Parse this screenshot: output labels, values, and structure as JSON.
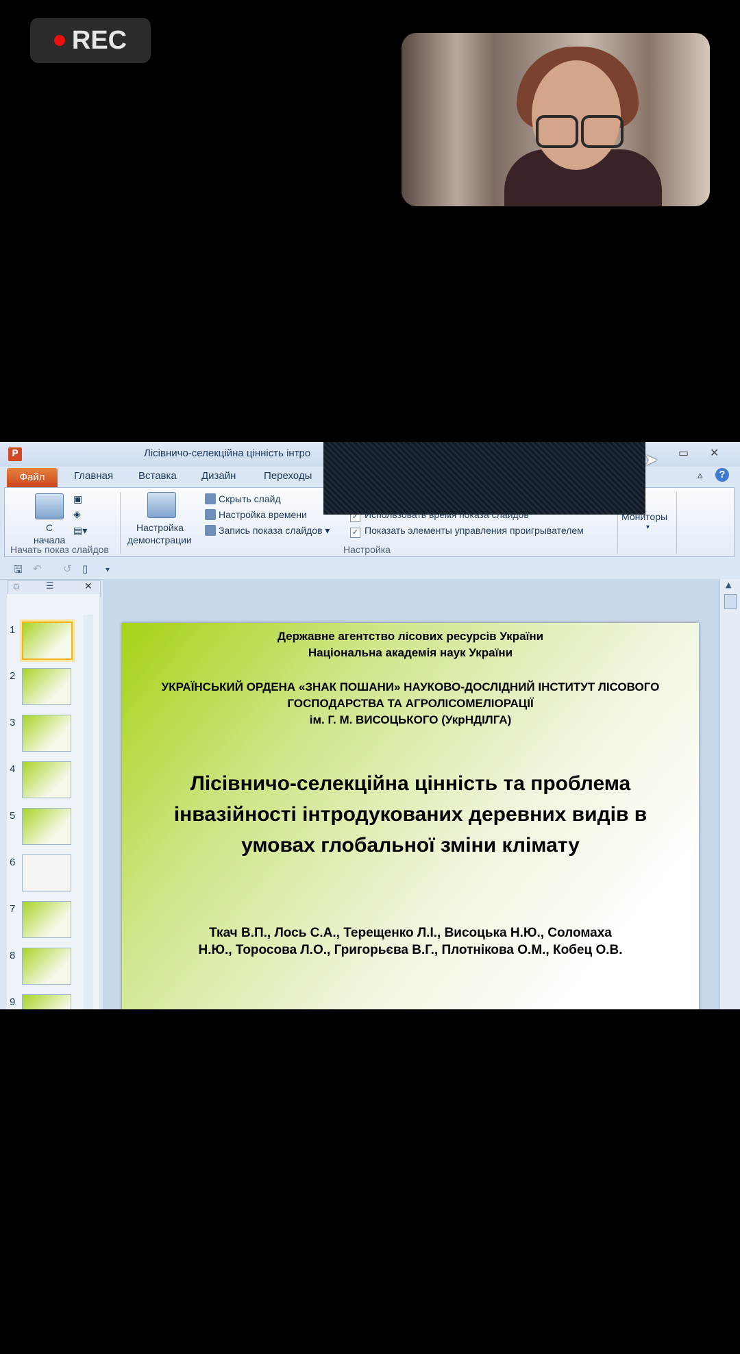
{
  "recording": {
    "label": "REC",
    "color": "#e81010"
  },
  "app": {
    "title": "Лісівничо-селекційна цінність інтро",
    "icon": "powerpoint-icon",
    "tabs": {
      "file": "Файл",
      "home": "Главная",
      "insert": "Вставка",
      "design": "Дизайн",
      "transitions": "Переходы"
    },
    "ribbon": {
      "from_start": "С",
      "from_start2": "начала",
      "setup_show": "Настройка",
      "setup_show2": "демонстрации",
      "hide_slide": "Скрыть слайд",
      "rehearse": "Настройка времени",
      "record": "Запись показа слайдов",
      "use_timings": "Использовать время показа слайдов",
      "show_controls": "Показать элементы управления проигрывателем",
      "monitors": "Мониторы",
      "group_start": "Начать показ слайдов",
      "group_setup": "Настройка"
    },
    "thumbnails": [
      "1",
      "2",
      "3",
      "4",
      "5",
      "6",
      "7",
      "8",
      "9"
    ],
    "selected_thumbnail": "1"
  },
  "slide": {
    "line1": "Державне агентство лісових ресурсів України",
    "line2": "Національна академія наук України",
    "line3": "УКРАЇНСЬКИЙ ОРДЕНА «ЗНАК ПОШАНИ» НАУКОВО-ДОСЛІДНИЙ ІНСТИТУТ ЛІСОВОГО",
    "line4": "ГОСПОДАРСТВА ТА АГРОЛІСОМЕЛІОРАЦІЇ",
    "line5": "ім. Г. М. ВИСОЦЬКОГО (УкрНДІЛГА)",
    "title1": "Лісівничо-селекційна цінність та проблема",
    "title2": "інвазійності інтродукованих деревних видів в",
    "title3": "умовах глобальної зміни клімату",
    "authors1": "Ткач В.П., Лось С.А.,  Терещенко Л.І., Висоцька Н.Ю., Соломаха",
    "authors2": "Н.Ю., Торосова Л.О., Григорьєва В.Г., Плотнікова О.М., Кобец О.В."
  }
}
